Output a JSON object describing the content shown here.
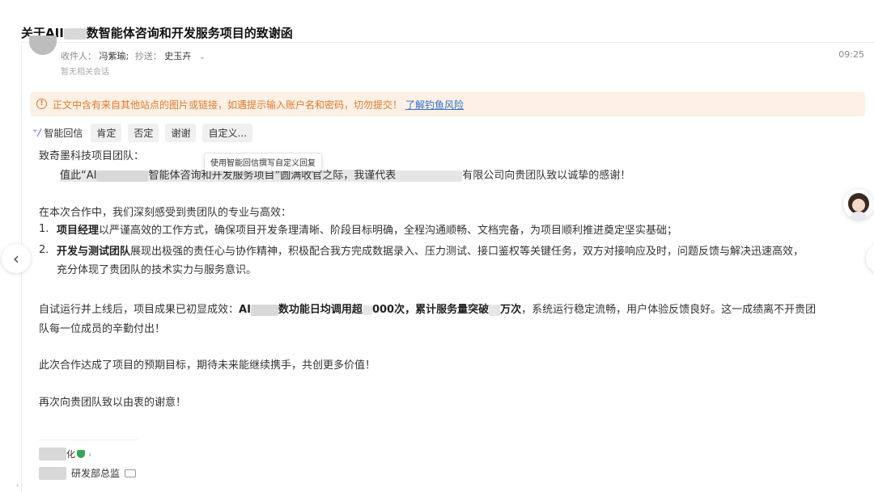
{
  "email": {
    "subject_prefix": "关于AII",
    "subject_suffix": "数智能体咨询和开发服务项目的致谢函",
    "recipients_label": "收件人：",
    "recipient": "冯紫瑜;",
    "cc_label": "抄送：",
    "cc": "史玉卉",
    "related": "暂无相关会话",
    "time": "09:25"
  },
  "warning": {
    "text": "正文中含有来自其他站点的图片或链接，如遇提示输入账户名和密码，切勿提交！",
    "link": "了解钓鱼风险"
  },
  "smart_reply": {
    "label": "智能回信",
    "chips": [
      "肯定",
      "否定",
      "谢谢",
      "自定义..."
    ],
    "tooltip": "使用智能回信撰写自定义回复"
  },
  "body": {
    "greeting": "致奇墨科技项目团队：",
    "p1_a": "值此“AI",
    "p1_b": "智能体咨询和开发服务项目”圆满收官之际，我谨代表",
    "p1_c": "有限公司向贵团队致以诚挚的感谢！",
    "p2": "在本次合作中，我们深刻感受到贵团队的专业与高效：",
    "items": [
      {
        "num": "1.",
        "bold": "项目经理",
        "text": "以严谨高效的工作方式，确保项目开发条理清晰、阶段目标明确，全程沟通顺畅、文档完备，为项目顺利推进奠定坚实基础；"
      },
      {
        "num": "2.",
        "bold": "开发与测试团队",
        "text": "展现出极强的责任心与协作精神，积极配合我方完成数据录入、压力测试、接口鉴权等关键任务，双方对接响应及时，问题反馈与解决迅速高效，",
        "text2": "充分体现了贵团队的技术实力与服务意识。"
      }
    ],
    "p3_a": "自试运行并上线后，项目成果已初显成效：",
    "p3_b": "AI",
    "p3_c": "数功能日均调用超",
    "p3_d": "000次，累计服务量突破",
    "p3_e": "万次",
    "p3_f": "，系统运行稳定流畅，用户体验反馈良好。这一成绩离不开贵团",
    "p3_g": "队每一位成员的辛勤付出！",
    "p4": "此次合作达成了项目的预期目标，期待未来能继续携手，共创更多价值！",
    "p5": "再次向贵团队致以由衷的谢意！"
  },
  "signature": {
    "name_suffix": "化",
    "title": "研发部总监"
  },
  "icons": [
    "warning-icon",
    "sparkle-icon",
    "chevron-left-icon",
    "assistant-avatar",
    "verified-shield-icon",
    "contact-card-icon"
  ],
  "colors": {
    "warning_bg": "#fdf0e4",
    "warning_text": "#e07a2f",
    "link": "#2f6fd0",
    "spark": "#6b5cf6"
  }
}
